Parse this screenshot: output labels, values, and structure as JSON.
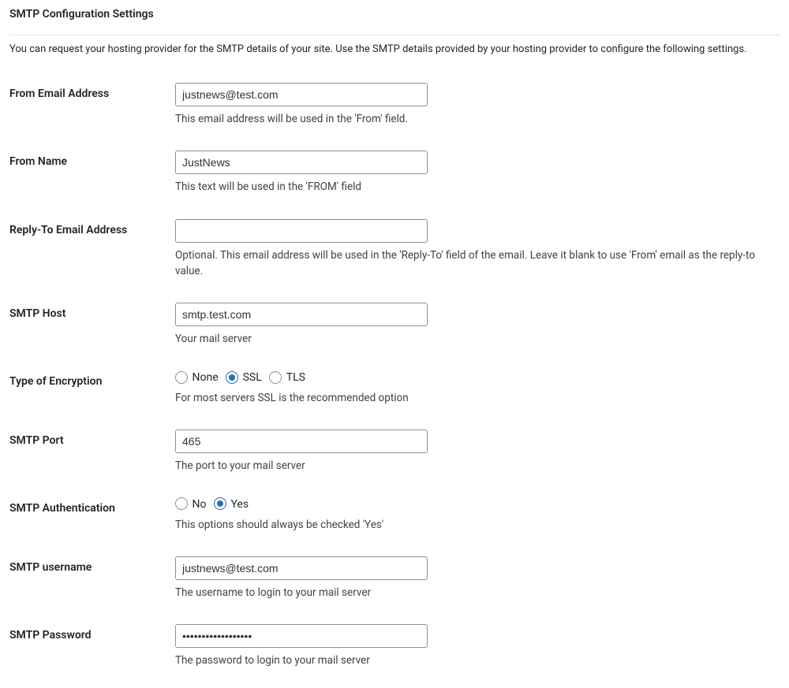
{
  "heading": "SMTP Configuration Settings",
  "intro": "You can request your hosting provider for the SMTP details of your site. Use the SMTP details provided by your hosting provider to configure the following settings.",
  "fields": {
    "from_email": {
      "label": "From Email Address",
      "value": "justnews@test.com",
      "description": "This email address will be used in the 'From' field."
    },
    "from_name": {
      "label": "From Name",
      "value": "JustNews",
      "description": "This text will be used in the 'FROM' field"
    },
    "reply_to": {
      "label": "Reply-To Email Address",
      "value": "",
      "description": "Optional. This email address will be used in the 'Reply-To' field of the email. Leave it blank to use 'From' email as the reply-to value."
    },
    "smtp_host": {
      "label": "SMTP Host",
      "value": "smtp.test.com",
      "description": "Your mail server"
    },
    "encryption": {
      "label": "Type of Encryption",
      "options": {
        "none": "None",
        "ssl": "SSL",
        "tls": "TLS"
      },
      "description": "For most servers SSL is the recommended option"
    },
    "smtp_port": {
      "label": "SMTP Port",
      "value": "465",
      "description": "The port to your mail server"
    },
    "smtp_auth": {
      "label": "SMTP Authentication",
      "options": {
        "no": "No",
        "yes": "Yes"
      },
      "description": "This options should always be checked 'Yes'"
    },
    "smtp_user": {
      "label": "SMTP username",
      "value": "justnews@test.com",
      "description": "The username to login to your mail server"
    },
    "smtp_pass": {
      "label": "SMTP Password",
      "value": "••••••••••••••••••",
      "description": "The password to login to your mail server"
    }
  }
}
